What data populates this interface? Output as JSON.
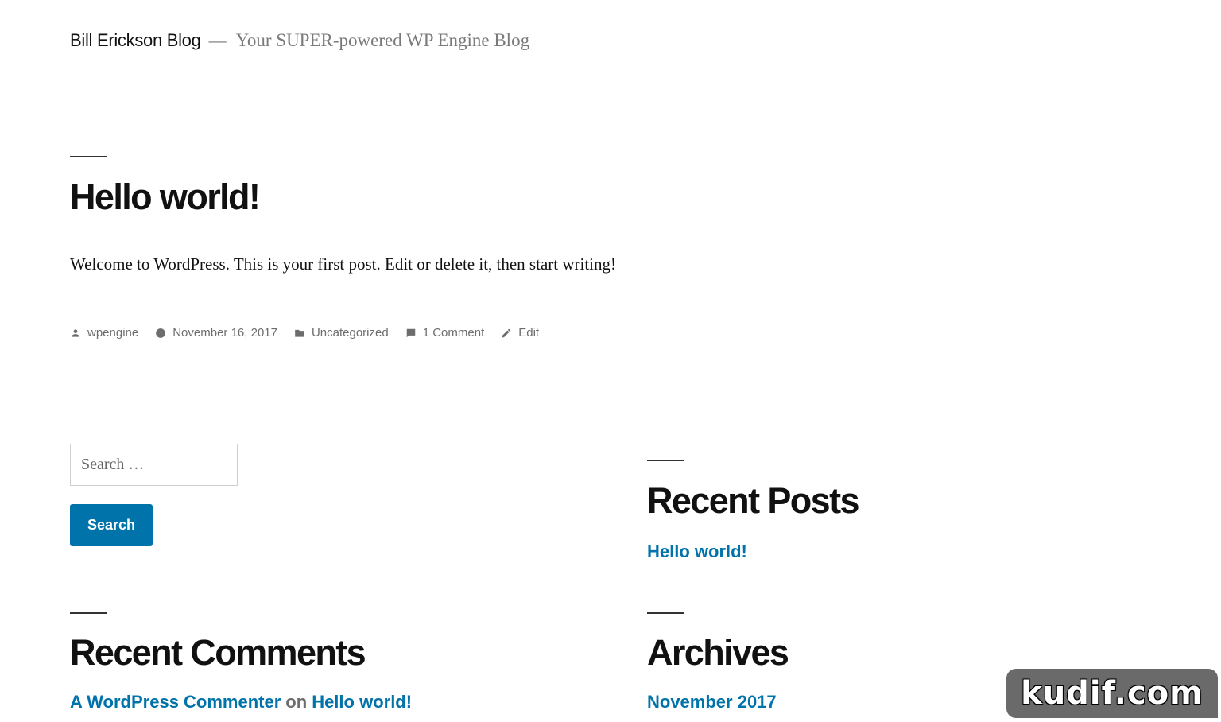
{
  "header": {
    "site_title": "Bill Erickson Blog",
    "separator": "—",
    "site_description": "Your SUPER-powered WP Engine Blog"
  },
  "post": {
    "title": "Hello world!",
    "body": "Welcome to WordPress. This is your first post. Edit or delete it, then start writing!",
    "meta": {
      "author": "wpengine",
      "date": "November 16, 2017",
      "category": "Uncategorized",
      "comments": "1 Comment",
      "edit": "Edit"
    }
  },
  "search": {
    "placeholder": "Search …",
    "button_label": "Search"
  },
  "widgets": {
    "recent_posts": {
      "title": "Recent Posts",
      "items": [
        "Hello world!"
      ]
    },
    "recent_comments": {
      "title": "Recent Comments",
      "author": "A WordPress Commenter",
      "on": "on",
      "post": "Hello world!"
    },
    "archives": {
      "title": "Archives",
      "items": [
        "November 2017"
      ]
    }
  },
  "watermark": "kudif.com",
  "colors": {
    "accent": "#0073aa",
    "meta_text": "#6d6d6d",
    "heading": "#111111"
  },
  "icons": {
    "author": "person-icon",
    "date": "clock-icon",
    "category": "folder-icon",
    "comments": "comment-icon",
    "edit": "pencil-icon"
  }
}
